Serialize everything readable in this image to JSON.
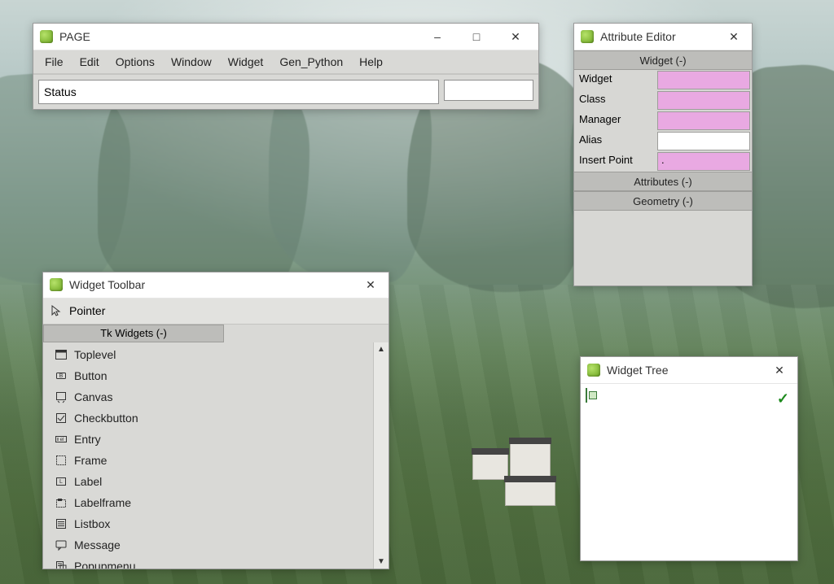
{
  "page_window": {
    "title": "PAGE",
    "menu": [
      "File",
      "Edit",
      "Options",
      "Window",
      "Widget",
      "Gen_Python",
      "Help"
    ],
    "status": "Status"
  },
  "attribute_editor": {
    "title": "Attribute Editor",
    "section_widget": "Widget (-)",
    "rows": [
      {
        "label": "Widget",
        "value": "",
        "style": "pink"
      },
      {
        "label": "Class",
        "value": "",
        "style": "pink"
      },
      {
        "label": "Manager",
        "value": "",
        "style": "pink"
      },
      {
        "label": "Alias",
        "value": "",
        "style": "white"
      },
      {
        "label": "Insert Point",
        "value": ".",
        "style": "pink"
      }
    ],
    "section_attributes": "Attributes (-)",
    "section_geometry": "Geometry (-)"
  },
  "widget_toolbar": {
    "title": "Widget Toolbar",
    "pointer": "Pointer",
    "section": "Tk Widgets (-)",
    "items": [
      {
        "icon": "toplevel",
        "label": "Toplevel"
      },
      {
        "icon": "button",
        "label": "Button"
      },
      {
        "icon": "canvas",
        "label": "Canvas"
      },
      {
        "icon": "checkbutton",
        "label": "Checkbutton"
      },
      {
        "icon": "entry",
        "label": "Entry"
      },
      {
        "icon": "frame",
        "label": "Frame"
      },
      {
        "icon": "label",
        "label": "Label"
      },
      {
        "icon": "labelframe",
        "label": "Labelframe"
      },
      {
        "icon": "listbox",
        "label": "Listbox"
      },
      {
        "icon": "message",
        "label": "Message"
      },
      {
        "icon": "popupmenu",
        "label": "Popupmenu"
      }
    ]
  },
  "widget_tree": {
    "title": "Widget Tree"
  }
}
